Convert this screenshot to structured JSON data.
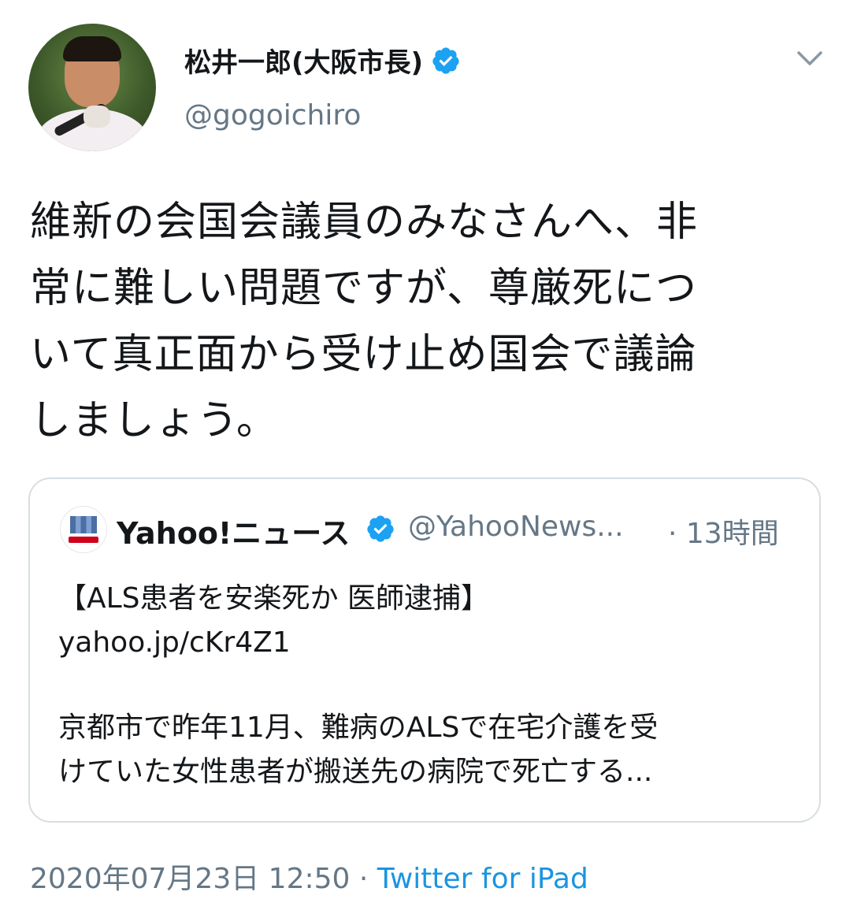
{
  "author": {
    "display_name": "松井一郎(大阪市長)",
    "handle": "@gogoichiro",
    "verified": true
  },
  "tweet": {
    "lines": [
      "維新の会国会議員のみなさんへ、非",
      "常に難しい問題ですが、尊厳死につ",
      "いて真正面から受け止め国会で議論",
      "しましょう。"
    ]
  },
  "quote": {
    "name": "Yahoo!ニュース",
    "handle": "@YahooNews...",
    "time": "· 13時間",
    "verified": true,
    "headline": "【ALS患者を安楽死か 医師逮捕】",
    "link": "yahoo.jp/cKr4Z1",
    "body_lines": [
      "京都市で昨年11月、難病のALSで在宅介護を受",
      "けていた女性患者が搬送先の病院で死亡する..."
    ]
  },
  "footer": {
    "timestamp": "2020年07月23日 12:50",
    "separator": "·",
    "client": "Twitter for iPad"
  },
  "icons": {
    "verified": "verified-badge-icon",
    "menu": "chevron-down-icon"
  },
  "colors": {
    "verified_blue": "#1da1f2",
    "link_blue": "#1b95e0",
    "secondary_text": "#657786"
  }
}
